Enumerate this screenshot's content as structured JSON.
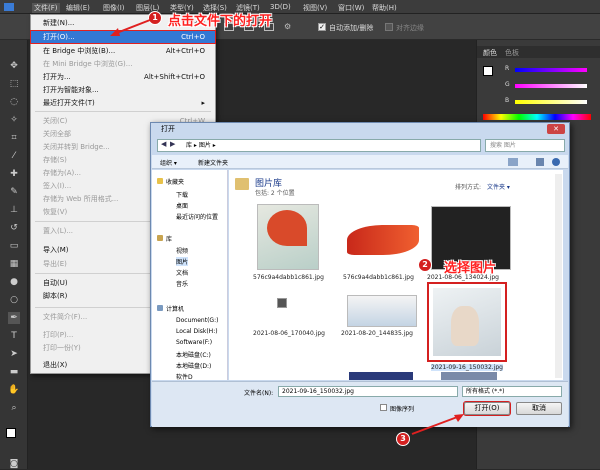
{
  "menubar": {
    "items": [
      "文件(F)",
      "编辑(E)",
      "图像(I)",
      "图层(L)",
      "类型(Y)",
      "选择(S)",
      "滤镜(T)",
      "3D(D)",
      "视图(V)",
      "窗口(W)",
      "帮助(H)"
    ]
  },
  "optbar": {
    "auto_add_delete": "自动添加/删除",
    "align_edges": "对齐边缘"
  },
  "file_menu": {
    "items": [
      {
        "label": "新建(N)...",
        "shortcut": "Ctrl+N",
        "disabled": false
      },
      {
        "label": "打开(O)...",
        "shortcut": "Ctrl+O",
        "disabled": false,
        "highlighted": true
      },
      {
        "label": "在 Bridge 中浏览(B)...",
        "shortcut": "Alt+Ctrl+O",
        "disabled": false
      },
      {
        "label": "在 Mini Bridge 中浏览(G)...",
        "shortcut": "",
        "disabled": true
      },
      {
        "label": "打开为...",
        "shortcut": "Alt+Shift+Ctrl+O",
        "disabled": false
      },
      {
        "label": "打开为智能对象...",
        "shortcut": "",
        "disabled": false
      },
      {
        "label": "最近打开文件(T)",
        "shortcut": "",
        "disabled": false,
        "submenu": true
      },
      {
        "label": "关闭(C)",
        "shortcut": "Ctrl+W",
        "disabled": true
      },
      {
        "label": "关闭全部",
        "shortcut": "",
        "disabled": true
      },
      {
        "label": "关闭并转到 Bridge...",
        "shortcut": "",
        "disabled": true
      },
      {
        "label": "存储(S)",
        "shortcut": "",
        "disabled": true
      },
      {
        "label": "存储为(A)...",
        "shortcut": "",
        "disabled": true
      },
      {
        "label": "签入(I)...",
        "shortcut": "",
        "disabled": true
      },
      {
        "label": "存储为 Web 所用格式...",
        "shortcut": "",
        "disabled": true
      },
      {
        "label": "恢复(V)",
        "shortcut": "",
        "disabled": true
      },
      {
        "label": "置入(L)...",
        "shortcut": "",
        "disabled": true
      },
      {
        "label": "导入(M)",
        "shortcut": "",
        "disabled": false,
        "submenu": true
      },
      {
        "label": "导出(E)",
        "shortcut": "",
        "disabled": true
      },
      {
        "label": "自动(U)",
        "shortcut": "",
        "disabled": false,
        "submenu": true
      },
      {
        "label": "脚本(R)",
        "shortcut": "",
        "disabled": false,
        "submenu": true
      },
      {
        "label": "文件简介(F)...",
        "shortcut": "",
        "disabled": true
      },
      {
        "label": "打印(P)...",
        "shortcut": "",
        "disabled": true
      },
      {
        "label": "打印一份(Y)",
        "shortcut": "",
        "disabled": true
      },
      {
        "label": "退出(X)",
        "shortcut": "",
        "disabled": false
      }
    ]
  },
  "annotations": {
    "step1_number": "1",
    "step1_text": "点击文件下的打开",
    "step2_number": "2",
    "step2_text": "选择图片",
    "step3_number": "3"
  },
  "dialog": {
    "title": "打开",
    "breadcrumb": "库 ▸ 图片 ▸",
    "search_placeholder": "搜索 图片",
    "toolbar": {
      "organize": "组织 ▾",
      "new_folder": "新建文件夹"
    },
    "nav": {
      "favorites": "收藏夹",
      "fav_items": [
        "下载",
        "桌面",
        "最近访问的位置"
      ],
      "libraries": "库",
      "lib_items": [
        "视频",
        "图片",
        "文档",
        "音乐"
      ],
      "computer": "计算机",
      "drives": [
        "Document(G:)",
        "Local Disk(H:)",
        "Software(F:)",
        "本地磁盘(C:)",
        "本地磁盘(D:)",
        "软件D"
      ]
    },
    "library_title": "图片库",
    "library_sub": "包括: 2 个位置",
    "arrange_label": "排列方式:",
    "arrange_value": "文件夹 ▾",
    "files": [
      "576c9a4dabb1c861.jpg",
      "576c9a4dabb1c861.jpg",
      "2021-08-06_134024.jpg",
      "2021-08-06_170040.jpg",
      "2021-08-20_144835.jpg",
      "2021-09-16_150032.jpg"
    ],
    "filename_label": "文件名(N):",
    "filename_value": "2021-09-16_150032.jpg",
    "filetype_value": "所有格式 (*.*)",
    "image_sequence": "图像序列",
    "open_button": "打开(O)",
    "cancel_button": "取消"
  },
  "right_panel": {
    "tab_color": "颜色",
    "tab_swatches": "色板",
    "r": "R",
    "g": "G",
    "b": "B"
  }
}
